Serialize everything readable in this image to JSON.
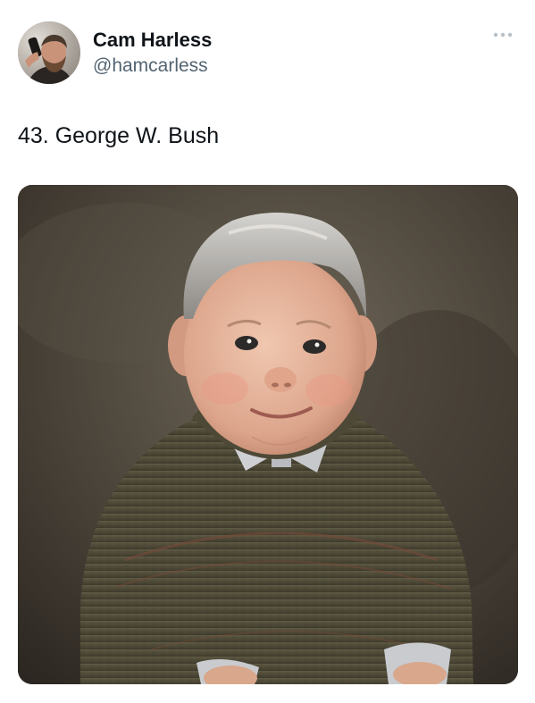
{
  "tweet": {
    "author": {
      "display_name": "Cam Harless",
      "handle": "@hamcarless",
      "avatar_icon": "profile-photo"
    },
    "more_icon": "more-horizontal-icon",
    "text": "43. George W. Bush",
    "media": {
      "type": "image",
      "icon": "photo",
      "depicts": "portrait-photo"
    }
  },
  "colors": {
    "text_primary": "#0f1419",
    "text_secondary": "#536471",
    "background": "#ffffff"
  }
}
